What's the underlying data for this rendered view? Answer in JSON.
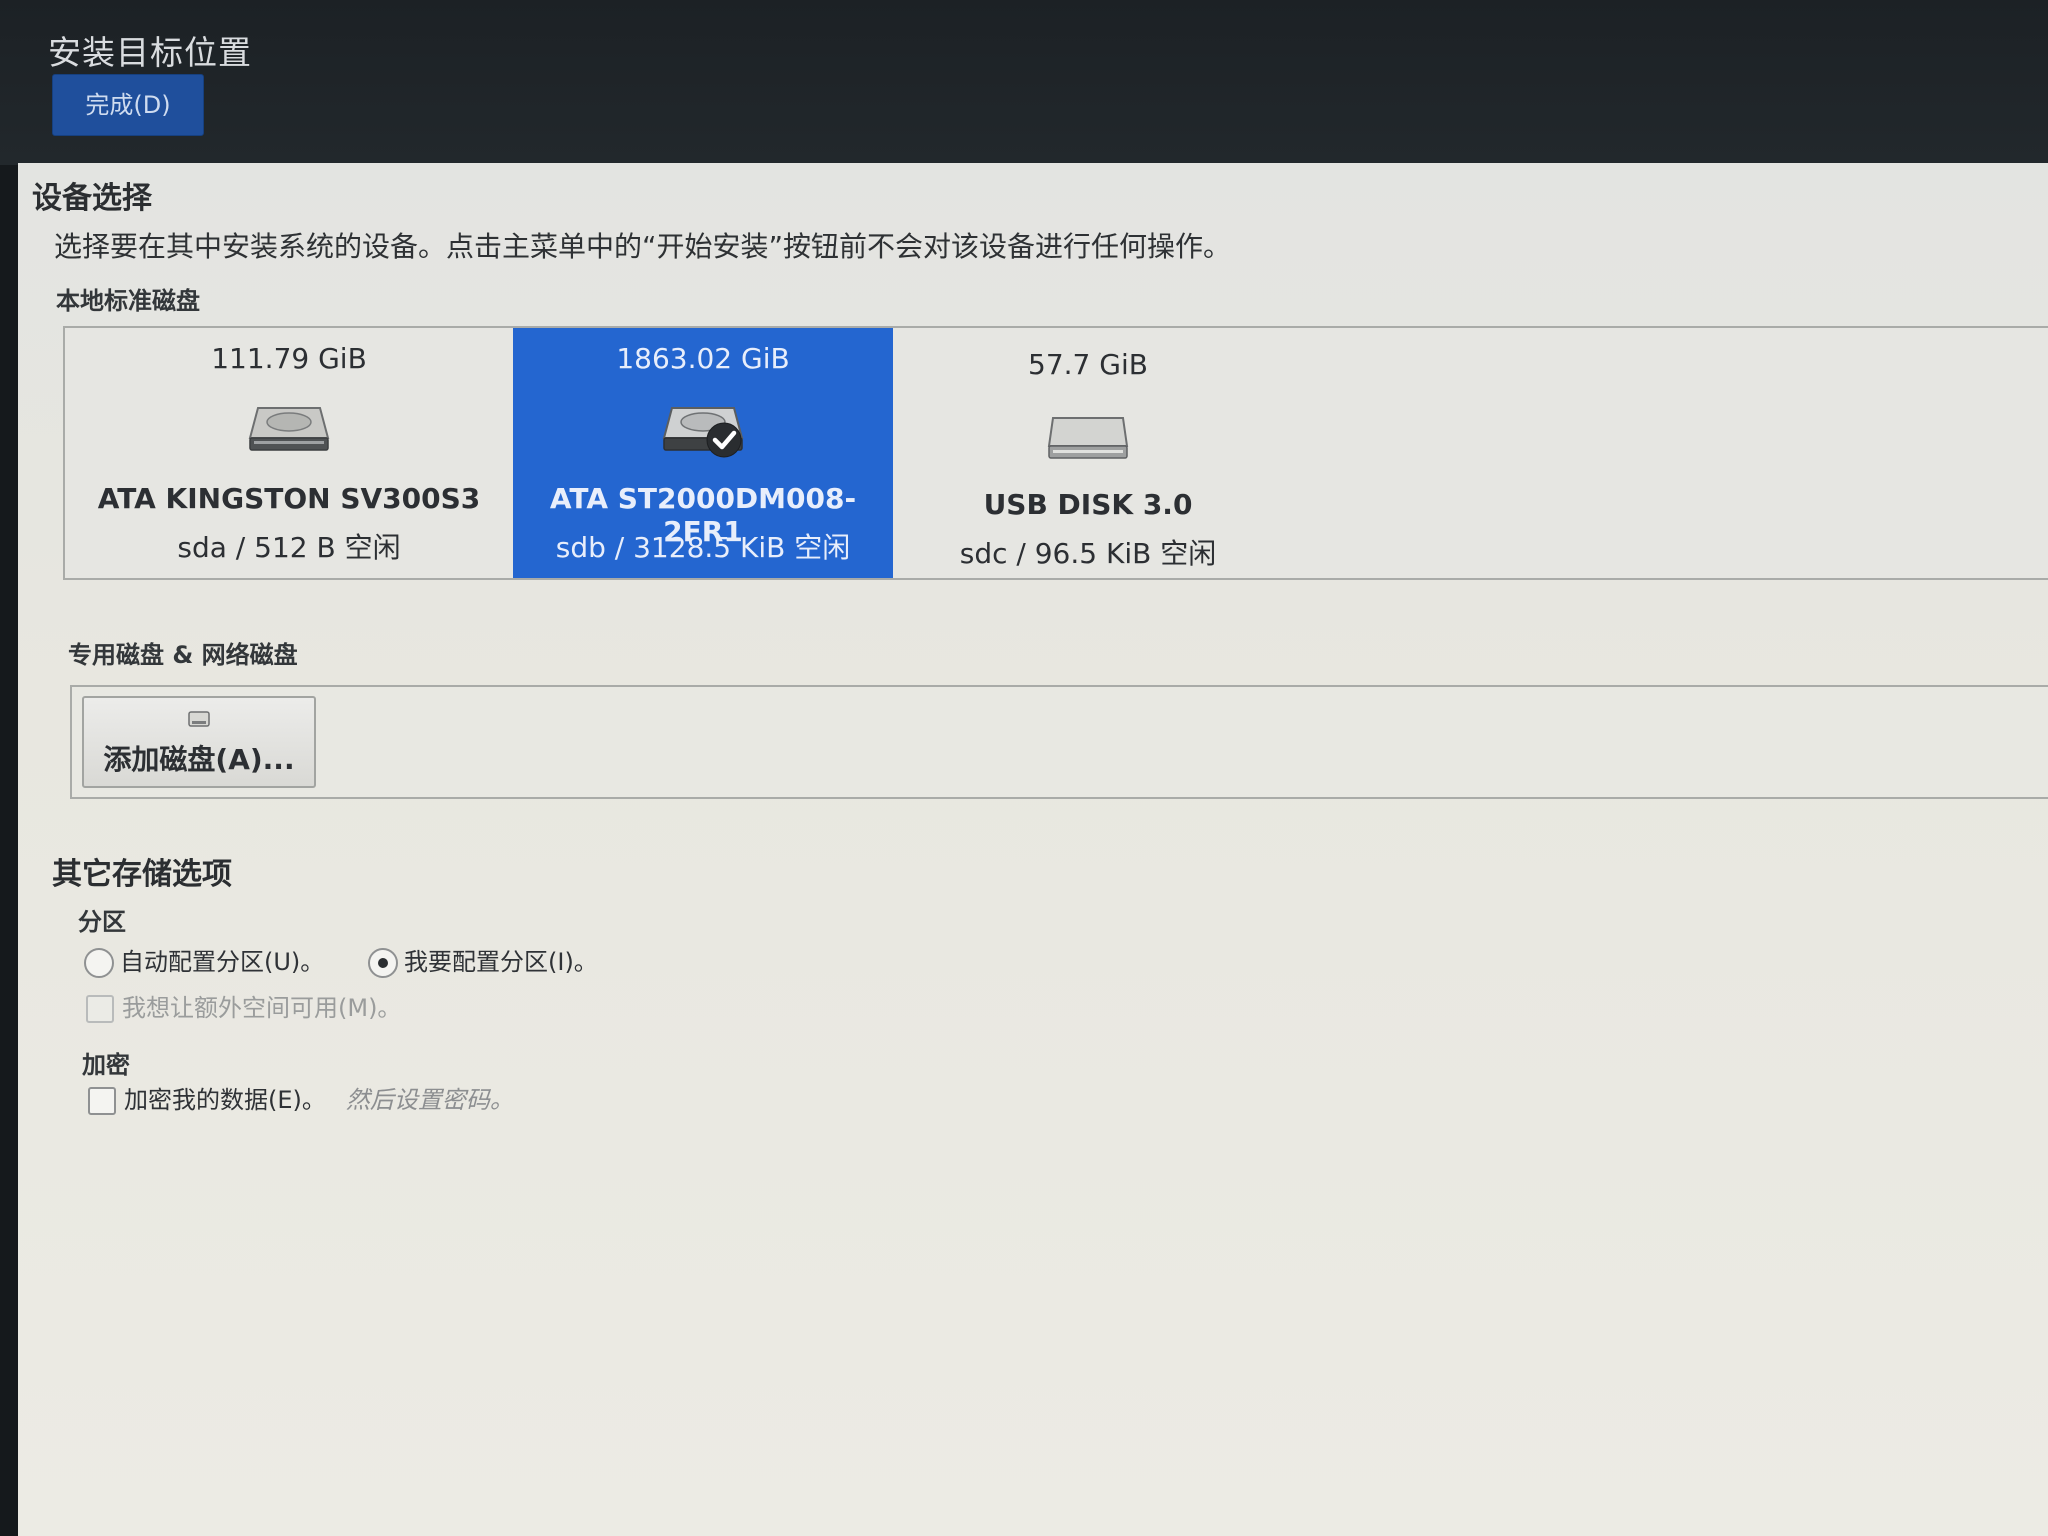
{
  "header": {
    "title": "安装目标位置",
    "done_label": "完成(D)"
  },
  "device_selection": {
    "title": "设备选择",
    "description": "选择要在其中安装系统的设备。点击主菜单中的“开始安装”按钮前不会对该设备进行任何操作。",
    "local_disks_heading": "本地标准磁盘",
    "disks": [
      {
        "size": "111.79 GiB",
        "model": "ATA KINGSTON SV300S3",
        "free": "sda   /   512 B 空闲",
        "selected": false,
        "icon": "hard-disk-icon"
      },
      {
        "size": "1863.02 GiB",
        "model": "ATA ST2000DM008-2FR1",
        "free": "sdb   /   3128.5 KiB 空闲",
        "selected": true,
        "icon": "hard-disk-icon"
      },
      {
        "size": "57.7 GiB",
        "model": "USB DISK 3.0",
        "free": "sdc  /  96.5 KiB 空闲",
        "selected": false,
        "icon": "usb-disk-icon"
      }
    ],
    "specialized_heading": "专用磁盘 & 网络磁盘",
    "add_disk_label": "添加磁盘(A)..."
  },
  "other_storage": {
    "title": "其它存储选项",
    "partitioning_heading": "分区",
    "auto_partition_label": "自动配置分区(U)。",
    "manual_partition_label": "我要配置分区(I)。",
    "partition_mode": "manual",
    "extra_space_label": "我想让额外空间可用(M)。",
    "encryption_heading": "加密",
    "encrypt_label": "加密我的数据(E)。",
    "encrypt_hint": "然后设置密码。"
  },
  "colors": {
    "selected_accent": "#2466d0",
    "done_button": "#1f4f9c"
  }
}
